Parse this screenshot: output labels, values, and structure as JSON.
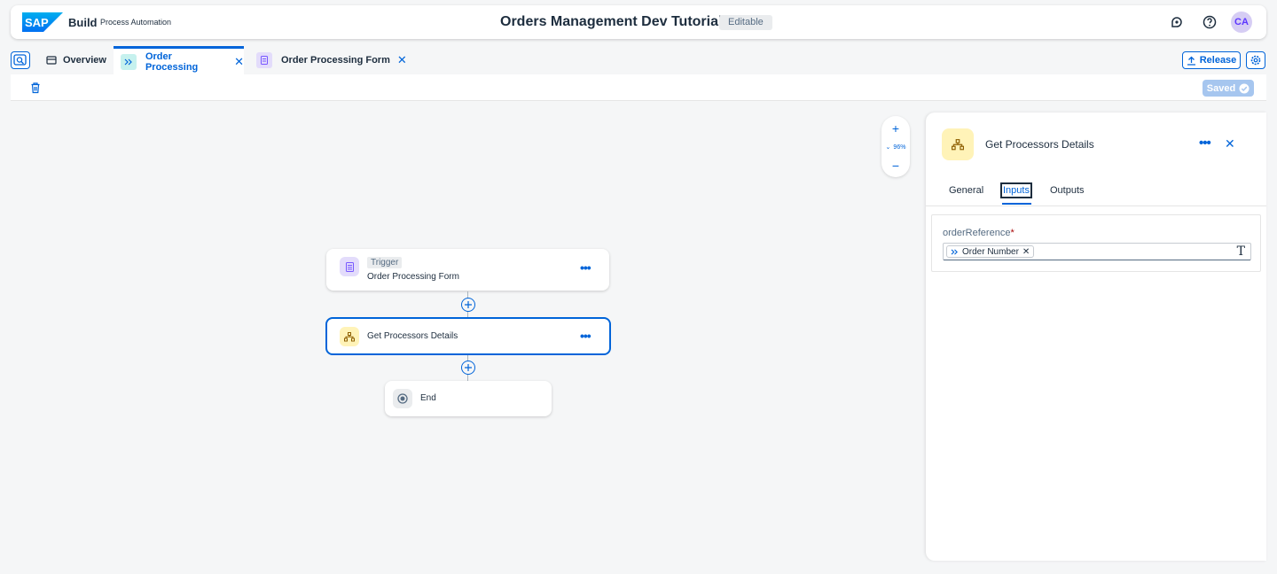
{
  "shell": {
    "brand": "Build",
    "product": "Process Automation",
    "project_title": "Orders Management Dev Tutorial",
    "status_badge": "Editable",
    "avatar": "CA"
  },
  "tabs": [
    {
      "label": "Overview",
      "icon": "overview-icon"
    },
    {
      "label": "Order Processing",
      "icon": "process-icon",
      "active": true
    },
    {
      "label": "Order Processing Form",
      "icon": "form-icon"
    }
  ],
  "actions": {
    "release_label": "Release",
    "saved_label": "Saved"
  },
  "zoom": {
    "plus": "+",
    "level": "96%",
    "minus": "−"
  },
  "flow": {
    "trigger": {
      "tag": "Trigger",
      "label": "Order Processing Form"
    },
    "step": {
      "label": "Get Processors Details"
    },
    "end": {
      "label": "End"
    }
  },
  "panel": {
    "title": "Get Processors Details",
    "tabs": [
      "General",
      "Inputs",
      "Outputs"
    ],
    "active_tab": "Inputs",
    "field": {
      "label": "orderReference",
      "required_mark": "*",
      "token": "Order Number"
    }
  },
  "colors": {
    "accent": "#0064d9",
    "trigger_icon_bg": "#e3dcfb",
    "action_icon_bg": "#fff3b8"
  }
}
